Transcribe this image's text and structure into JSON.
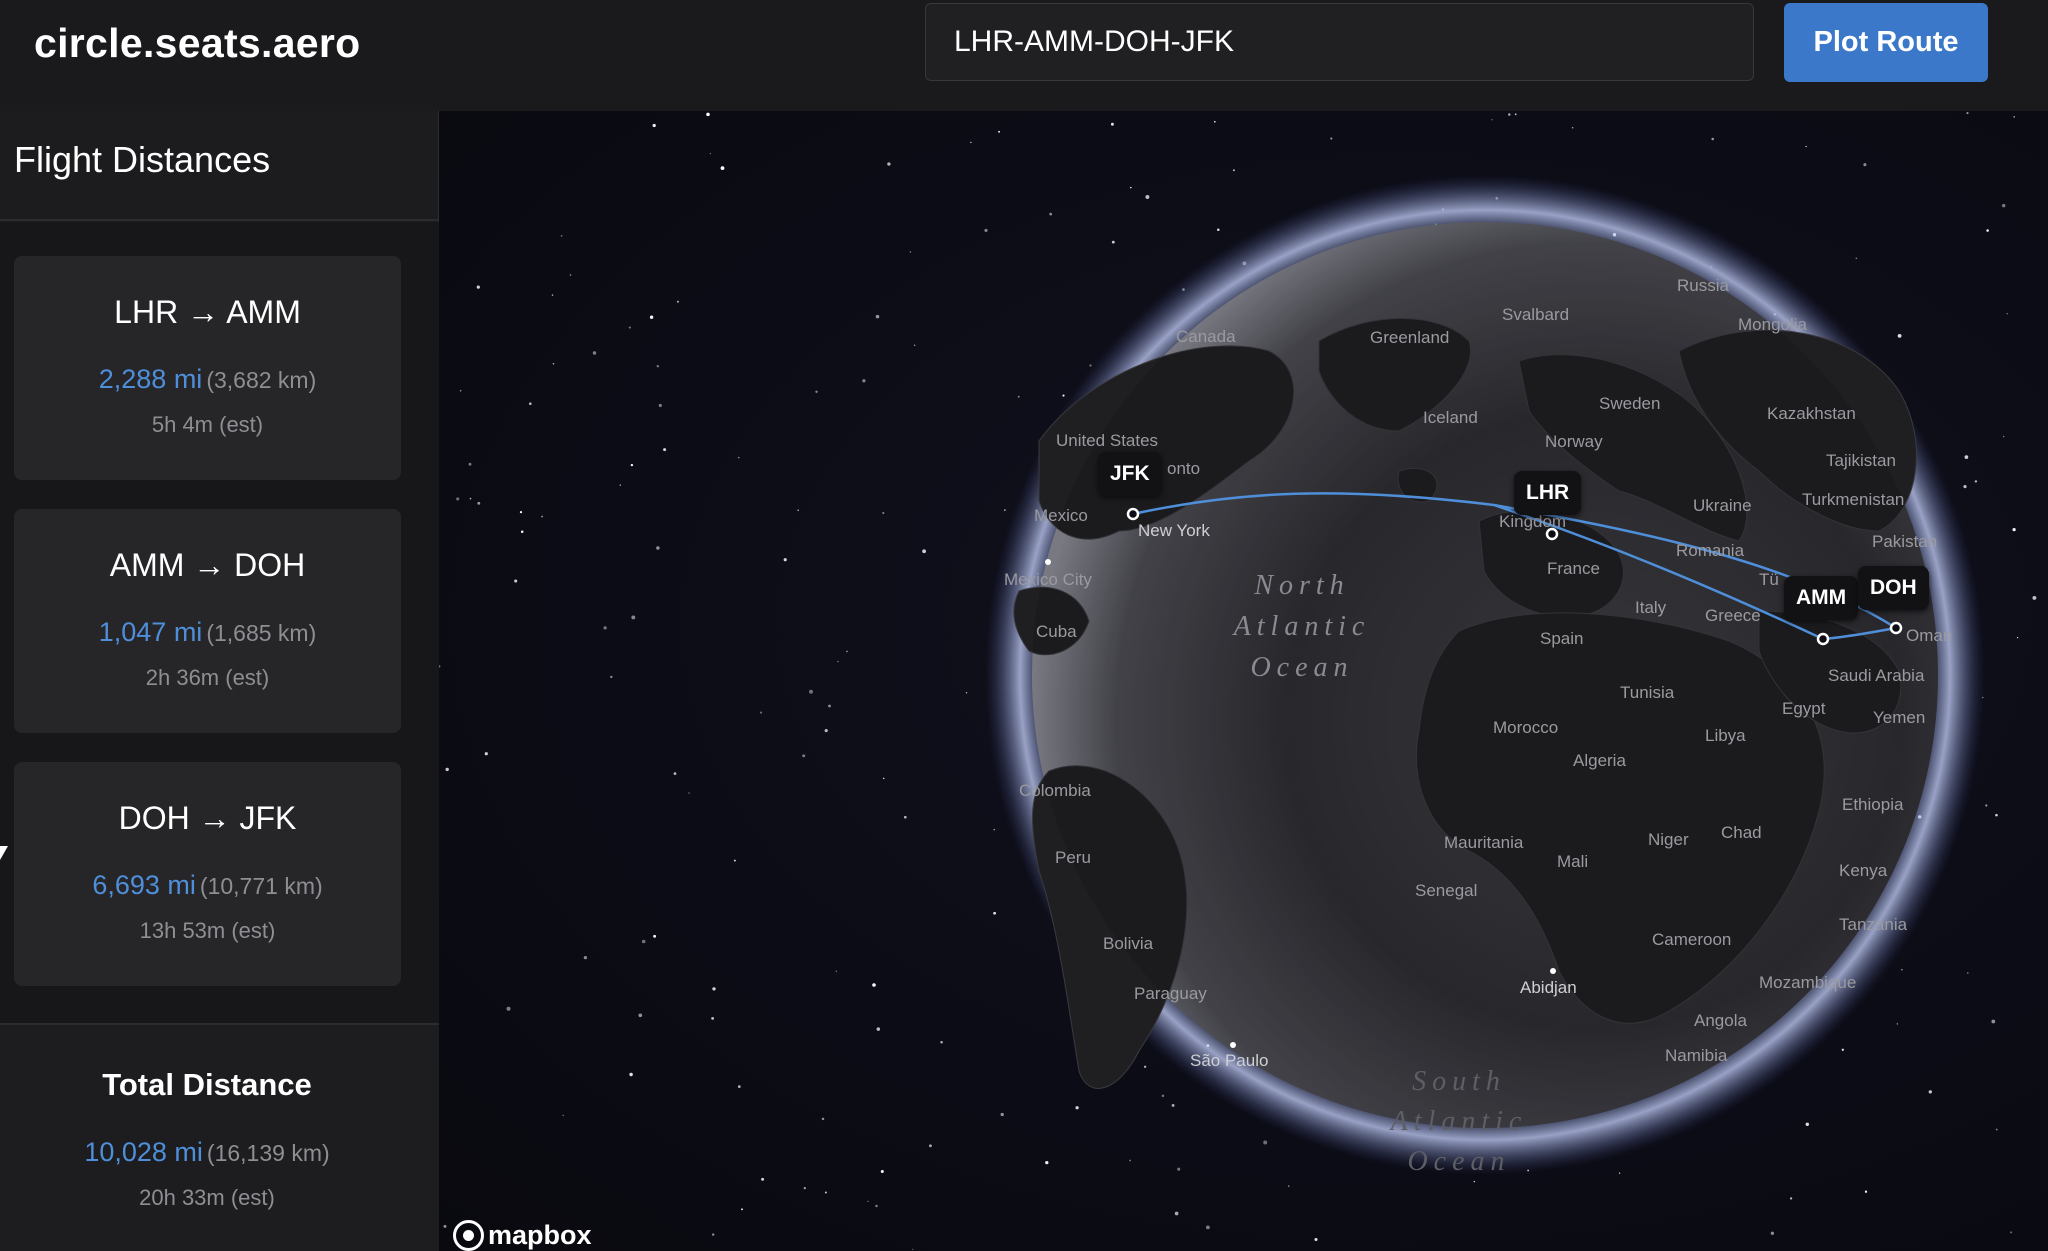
{
  "header": {
    "logo": "circle.seats.aero",
    "route_input_value": "LHR-AMM-DOH-JFK",
    "plot_button": "Plot Route"
  },
  "sidebar": {
    "title": "Flight Distances",
    "legs": [
      {
        "title": "LHR → AMM",
        "miles": "2,288 mi",
        "km": "(3,682 km)",
        "time": "5h 4m (est)"
      },
      {
        "title": "AMM → DOH",
        "miles": "1,047 mi",
        "km": "(1,685 km)",
        "time": "2h 36m (est)"
      },
      {
        "title": "DOH → JFK",
        "miles": "6,693 mi",
        "km": "(10,771 km)",
        "time": "13h 53m (est)"
      }
    ],
    "total": {
      "title": "Total Distance",
      "miles": "10,028 mi",
      "km": "(16,139 km)",
      "time": "20h 33m (est)"
    }
  },
  "map": {
    "airports": [
      "JFK",
      "LHR",
      "AMM",
      "DOH"
    ],
    "oceans": {
      "north_atlantic": [
        "North",
        "Atlantic",
        "Ocean"
      ],
      "south_atlantic": [
        "South",
        "Atlantic",
        "Ocean"
      ]
    },
    "places": {
      "russia": "Russia",
      "svalbard": "Svalbard",
      "mongolia": "Mongolia",
      "canada": "Canada",
      "greenland": "Greenland",
      "iceland": "Iceland",
      "sweden": "Sweden",
      "norway": "Norway",
      "kazakhstan": "Kazakhstan",
      "united_states": "United States",
      "toronto_partial": "onto",
      "tajikistan": "Tajikistan",
      "turkmenistan": "Turkmenistan",
      "ukraine": "Ukraine",
      "kingdom": "Kingdom",
      "mexico": "Mexico",
      "new_york": "New York",
      "romania": "Romania",
      "pakistan": "Pakistan",
      "france": "France",
      "mexico_city": "Mexico City",
      "turkiye_partial": "Tü",
      "italy": "Italy",
      "greece": "Greece",
      "oman": "Oman",
      "cuba": "Cuba",
      "spain": "Spain",
      "saudi_arabia": "Saudi Arabia",
      "tunisia": "Tunisia",
      "egypt": "Egypt",
      "yemen": "Yemen",
      "morocco": "Morocco",
      "libya": "Libya",
      "algeria": "Algeria",
      "colombia": "Colombia",
      "ethiopia": "Ethiopia",
      "chad": "Chad",
      "mauritania": "Mauritania",
      "niger": "Niger",
      "peru": "Peru",
      "mali": "Mali",
      "kenya": "Kenya",
      "senegal": "Senegal",
      "tanzania": "Tanzania",
      "cameroon": "Cameroon",
      "bolivia": "Bolivia",
      "abidjan": "Abidjan",
      "mozambique": "Mozambique",
      "paraguay": "Paraguay",
      "angola": "Angola",
      "namibia": "Namibia",
      "sao_paulo": "São Paulo"
    },
    "attribution": "mapbox",
    "route_color": "#4f8ed9"
  }
}
